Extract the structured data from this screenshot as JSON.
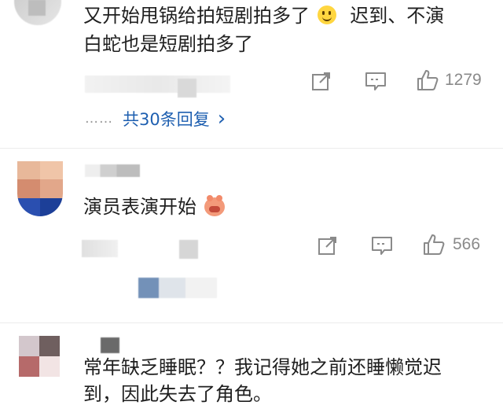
{
  "comments": [
    {
      "text": "又开始甩锅给拍短剧拍多了🙂 迟到、不演白蛇也是短剧拍多了",
      "line1": "又开始甩锅给拍短剧拍多了",
      "line1_tail": "迟到、不演",
      "line2": "白蛇也是短剧拍多了",
      "emoji": "smile-emoji",
      "likes": "1279",
      "more_dots": "……",
      "replies_label": "共30条回复",
      "replies_chevron": "›"
    },
    {
      "text": "演员表演开始",
      "emoji": "pig-laugh-emoji",
      "likes": "566"
    },
    {
      "line1": "常年缺乏睡眠？？我记得她之前还睡懒觉迟",
      "line2": "到，因此失去了角色。"
    }
  ],
  "icons": {
    "share": "share-icon",
    "comment": "comment-icon",
    "like": "thumbs-up-icon"
  },
  "colors": {
    "link": "#1e5fb0",
    "muted": "#8a8a8a",
    "divider": "#ececec"
  }
}
